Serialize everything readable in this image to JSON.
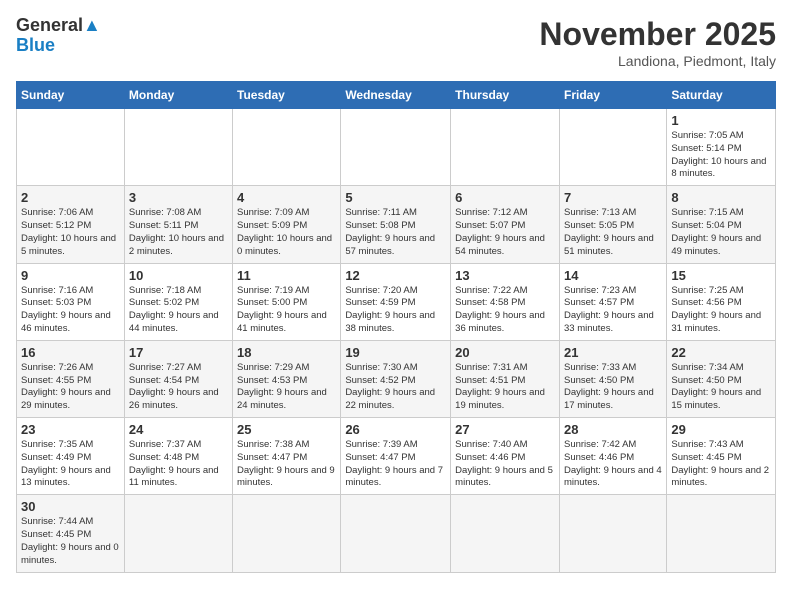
{
  "header": {
    "logo_general": "General",
    "logo_blue": "Blue",
    "month_title": "November 2025",
    "subtitle": "Landiona, Piedmont, Italy"
  },
  "days_of_week": [
    "Sunday",
    "Monday",
    "Tuesday",
    "Wednesday",
    "Thursday",
    "Friday",
    "Saturday"
  ],
  "weeks": [
    [
      {
        "day": "",
        "info": ""
      },
      {
        "day": "",
        "info": ""
      },
      {
        "day": "",
        "info": ""
      },
      {
        "day": "",
        "info": ""
      },
      {
        "day": "",
        "info": ""
      },
      {
        "day": "",
        "info": ""
      },
      {
        "day": "1",
        "info": "Sunrise: 7:05 AM\nSunset: 5:14 PM\nDaylight: 10 hours and 8 minutes."
      }
    ],
    [
      {
        "day": "2",
        "info": "Sunrise: 7:06 AM\nSunset: 5:12 PM\nDaylight: 10 hours and 5 minutes."
      },
      {
        "day": "3",
        "info": "Sunrise: 7:08 AM\nSunset: 5:11 PM\nDaylight: 10 hours and 2 minutes."
      },
      {
        "day": "4",
        "info": "Sunrise: 7:09 AM\nSunset: 5:09 PM\nDaylight: 10 hours and 0 minutes."
      },
      {
        "day": "5",
        "info": "Sunrise: 7:11 AM\nSunset: 5:08 PM\nDaylight: 9 hours and 57 minutes."
      },
      {
        "day": "6",
        "info": "Sunrise: 7:12 AM\nSunset: 5:07 PM\nDaylight: 9 hours and 54 minutes."
      },
      {
        "day": "7",
        "info": "Sunrise: 7:13 AM\nSunset: 5:05 PM\nDaylight: 9 hours and 51 minutes."
      },
      {
        "day": "8",
        "info": "Sunrise: 7:15 AM\nSunset: 5:04 PM\nDaylight: 9 hours and 49 minutes."
      }
    ],
    [
      {
        "day": "9",
        "info": "Sunrise: 7:16 AM\nSunset: 5:03 PM\nDaylight: 9 hours and 46 minutes."
      },
      {
        "day": "10",
        "info": "Sunrise: 7:18 AM\nSunset: 5:02 PM\nDaylight: 9 hours and 44 minutes."
      },
      {
        "day": "11",
        "info": "Sunrise: 7:19 AM\nSunset: 5:00 PM\nDaylight: 9 hours and 41 minutes."
      },
      {
        "day": "12",
        "info": "Sunrise: 7:20 AM\nSunset: 4:59 PM\nDaylight: 9 hours and 38 minutes."
      },
      {
        "day": "13",
        "info": "Sunrise: 7:22 AM\nSunset: 4:58 PM\nDaylight: 9 hours and 36 minutes."
      },
      {
        "day": "14",
        "info": "Sunrise: 7:23 AM\nSunset: 4:57 PM\nDaylight: 9 hours and 33 minutes."
      },
      {
        "day": "15",
        "info": "Sunrise: 7:25 AM\nSunset: 4:56 PM\nDaylight: 9 hours and 31 minutes."
      }
    ],
    [
      {
        "day": "16",
        "info": "Sunrise: 7:26 AM\nSunset: 4:55 PM\nDaylight: 9 hours and 29 minutes."
      },
      {
        "day": "17",
        "info": "Sunrise: 7:27 AM\nSunset: 4:54 PM\nDaylight: 9 hours and 26 minutes."
      },
      {
        "day": "18",
        "info": "Sunrise: 7:29 AM\nSunset: 4:53 PM\nDaylight: 9 hours and 24 minutes."
      },
      {
        "day": "19",
        "info": "Sunrise: 7:30 AM\nSunset: 4:52 PM\nDaylight: 9 hours and 22 minutes."
      },
      {
        "day": "20",
        "info": "Sunrise: 7:31 AM\nSunset: 4:51 PM\nDaylight: 9 hours and 19 minutes."
      },
      {
        "day": "21",
        "info": "Sunrise: 7:33 AM\nSunset: 4:50 PM\nDaylight: 9 hours and 17 minutes."
      },
      {
        "day": "22",
        "info": "Sunrise: 7:34 AM\nSunset: 4:50 PM\nDaylight: 9 hours and 15 minutes."
      }
    ],
    [
      {
        "day": "23",
        "info": "Sunrise: 7:35 AM\nSunset: 4:49 PM\nDaylight: 9 hours and 13 minutes."
      },
      {
        "day": "24",
        "info": "Sunrise: 7:37 AM\nSunset: 4:48 PM\nDaylight: 9 hours and 11 minutes."
      },
      {
        "day": "25",
        "info": "Sunrise: 7:38 AM\nSunset: 4:47 PM\nDaylight: 9 hours and 9 minutes."
      },
      {
        "day": "26",
        "info": "Sunrise: 7:39 AM\nSunset: 4:47 PM\nDaylight: 9 hours and 7 minutes."
      },
      {
        "day": "27",
        "info": "Sunrise: 7:40 AM\nSunset: 4:46 PM\nDaylight: 9 hours and 5 minutes."
      },
      {
        "day": "28",
        "info": "Sunrise: 7:42 AM\nSunset: 4:46 PM\nDaylight: 9 hours and 4 minutes."
      },
      {
        "day": "29",
        "info": "Sunrise: 7:43 AM\nSunset: 4:45 PM\nDaylight: 9 hours and 2 minutes."
      }
    ],
    [
      {
        "day": "30",
        "info": "Sunrise: 7:44 AM\nSunset: 4:45 PM\nDaylight: 9 hours and 0 minutes."
      },
      {
        "day": "",
        "info": ""
      },
      {
        "day": "",
        "info": ""
      },
      {
        "day": "",
        "info": ""
      },
      {
        "day": "",
        "info": ""
      },
      {
        "day": "",
        "info": ""
      },
      {
        "day": "",
        "info": ""
      }
    ]
  ]
}
